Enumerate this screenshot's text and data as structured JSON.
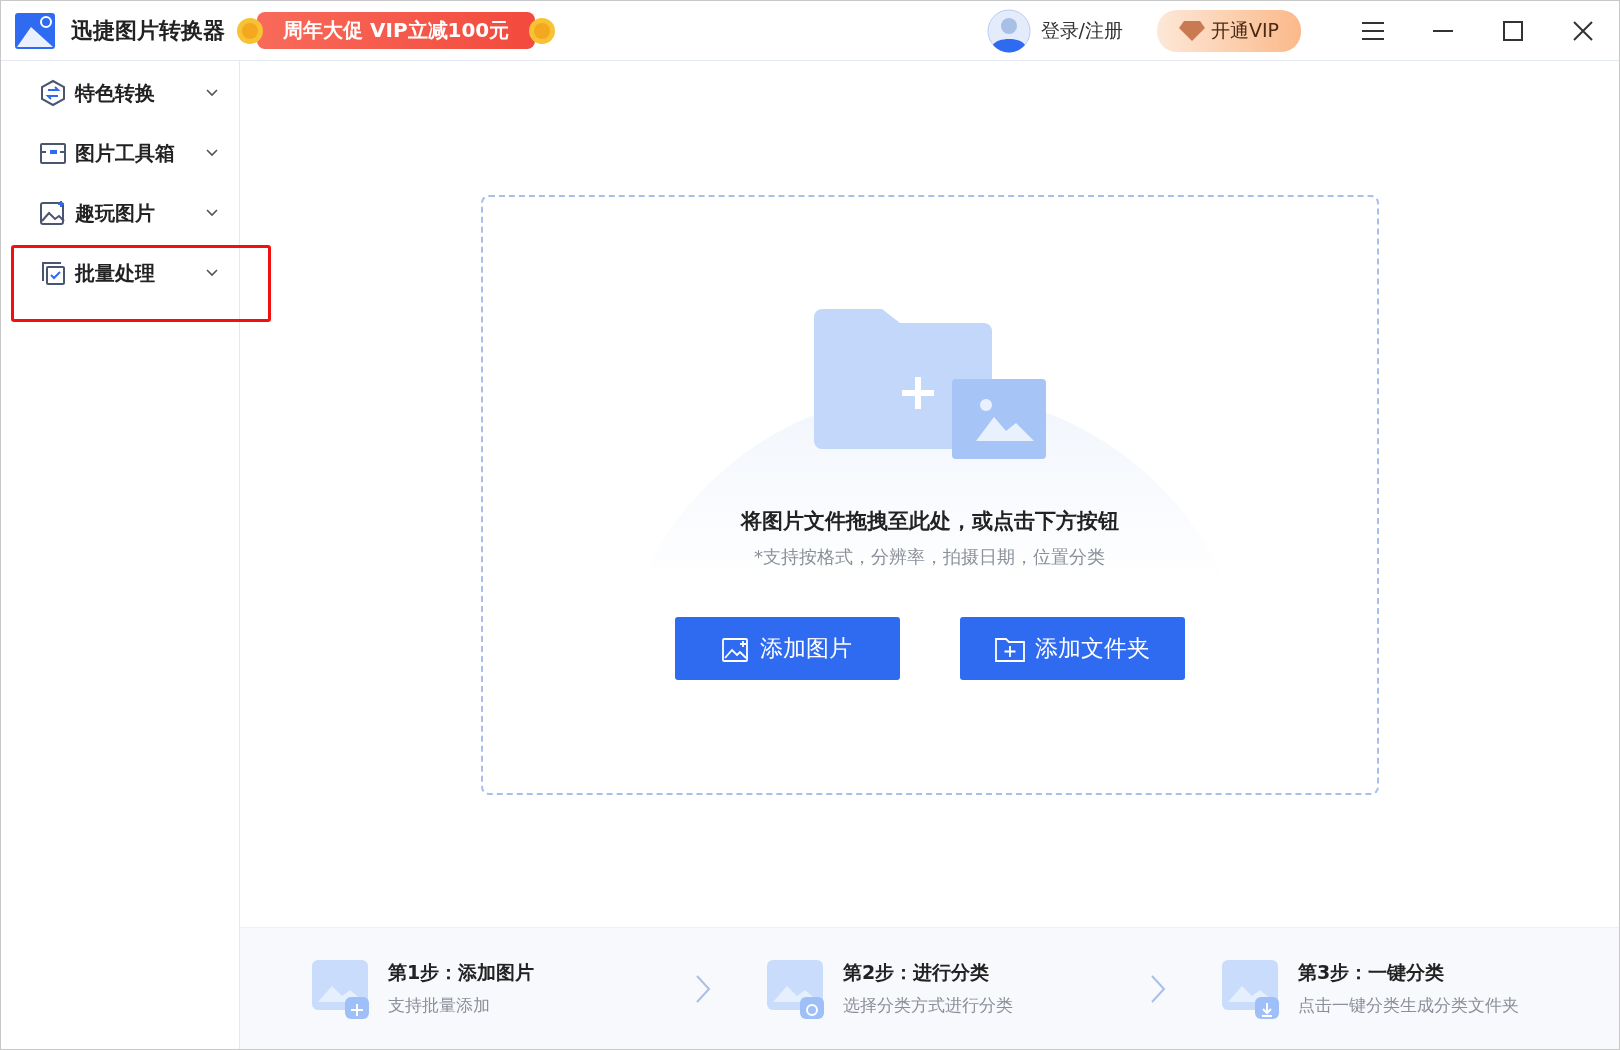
{
  "window": {
    "title": "迅捷图片转换器",
    "promo": "周年大促 VIP立减100元",
    "login": "登录/注册",
    "vip": "开通VIP"
  },
  "sidebar": {
    "items": [
      {
        "label": "特色转换",
        "kind": "convert",
        "highlighted": false
      },
      {
        "label": "图片工具箱",
        "kind": "toolbox",
        "highlighted": false
      },
      {
        "label": "趣玩图片",
        "kind": "fun",
        "highlighted": false
      },
      {
        "label": "批量处理",
        "kind": "batch",
        "highlighted": true
      }
    ]
  },
  "dropzone": {
    "title": "将图片文件拖拽至此处，或点击下方按钮",
    "subtitle": "*支持按格式，分辨率，拍摄日期，位置分类",
    "buttons": [
      {
        "label": "添加图片",
        "kind": "image"
      },
      {
        "label": "添加文件夹",
        "kind": "folder"
      }
    ]
  },
  "steps": [
    {
      "title": "第1步：添加图片",
      "desc": "支持批量添加",
      "kind": "add"
    },
    {
      "title": "第2步：进行分类",
      "desc": "选择分类方式进行分类",
      "kind": "sort"
    },
    {
      "title": "第3步：一键分类",
      "desc": "点击一键分类生成分类文件夹",
      "kind": "download"
    }
  ]
}
